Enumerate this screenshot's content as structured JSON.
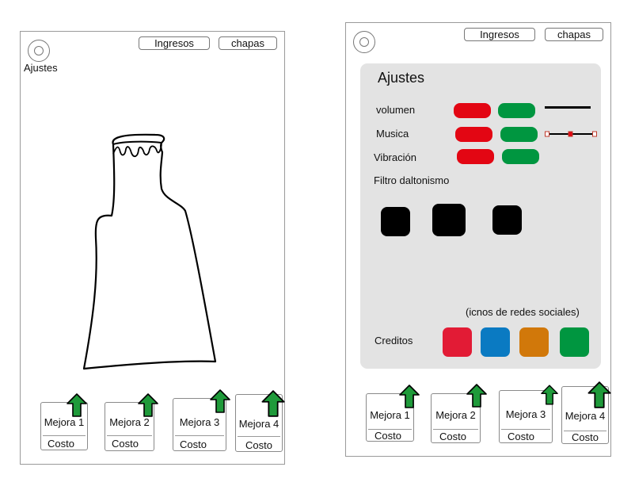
{
  "colors": {
    "toggle_red": "#e30613",
    "toggle_green": "#009640",
    "social_red": "#e21b35",
    "social_blue": "#0a7ac2",
    "social_orange": "#d1780a",
    "social_green": "#009640",
    "arrow_green": "#1f9a3a"
  },
  "header": {
    "ingresos_label": "Ingresos",
    "chapas_label": "chapas"
  },
  "left_screen": {
    "ajustes_label": "Ajustes"
  },
  "settings": {
    "title": "Ajustes",
    "volumen_label": "volumen",
    "musica_label": "Musica",
    "vibracion_label": "Vibración",
    "filtro_label": "Filtro daltonismo",
    "redes_label": "(icnos de redes sociales)",
    "creditos_label": "Creditos"
  },
  "upgrades": [
    {
      "name": "Mejora 1",
      "cost": "Costo"
    },
    {
      "name": "Mejora 2",
      "cost": "Costo"
    },
    {
      "name": "Mejora 3",
      "cost": "Costo"
    },
    {
      "name": "Mejora 4",
      "cost": "Costo"
    }
  ]
}
